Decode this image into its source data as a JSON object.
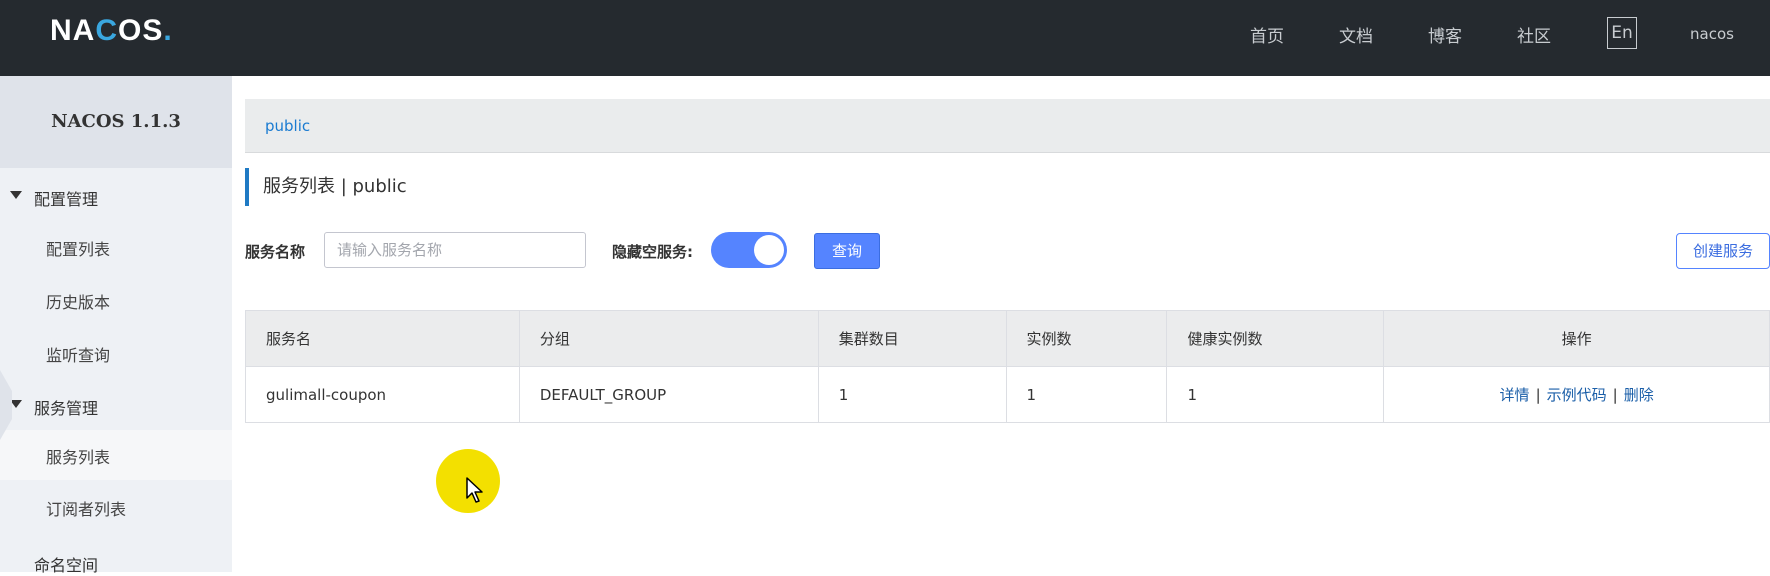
{
  "header": {
    "logo_prefix": "NA",
    "logo_ring": "C",
    "logo_suffix": "OS",
    "logo_dot": ".",
    "nav": [
      "首页",
      "文档",
      "博客",
      "社区"
    ],
    "lang": "En",
    "user": "nacos"
  },
  "sidebar": {
    "title": "NACOS 1.1.3",
    "groups": [
      {
        "label": "配置管理",
        "items": [
          "配置列表",
          "历史版本",
          "监听查询"
        ]
      },
      {
        "label": "服务管理",
        "items": [
          "服务列表",
          "订阅者列表"
        ]
      }
    ],
    "namespace": "命名空间",
    "active_item": "服务列表"
  },
  "breadcrumb": {
    "namespace": "public"
  },
  "page": {
    "title": "服务列表 | public"
  },
  "filter": {
    "name_label": "服务名称",
    "name_placeholder": "请输入服务名称",
    "hide_empty_label": "隐藏空服务:",
    "hide_empty_on": true,
    "query_button": "查询",
    "create_button": "创建服务"
  },
  "table": {
    "headers": [
      "服务名",
      "分组",
      "集群数目",
      "实例数",
      "健康实例数",
      "操作"
    ],
    "rows": [
      {
        "service": "gulimall-coupon",
        "group": "DEFAULT_GROUP",
        "clusters": "1",
        "instances": "1",
        "healthy": "1",
        "actions": [
          "详情",
          "示例代码",
          "删除"
        ]
      }
    ],
    "action_separator": "|"
  },
  "colors": {
    "topbar": "#252a2f",
    "accent": "#5584ff",
    "link": "#1a5ea8",
    "cursor_highlight": "#f3e000"
  }
}
